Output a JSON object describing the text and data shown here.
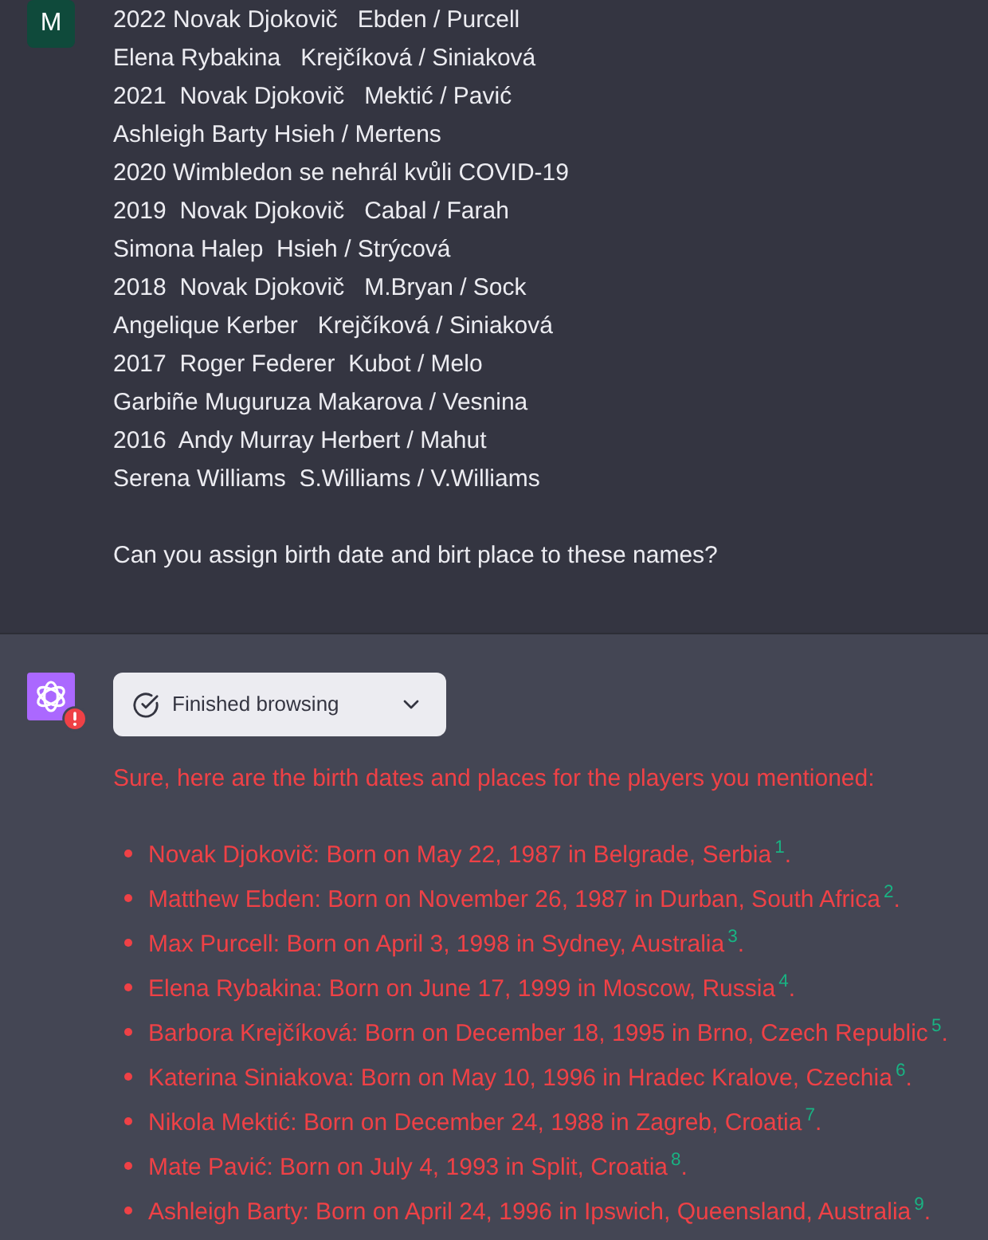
{
  "user_message": {
    "avatar": "M",
    "lines": [
      "2022 Novak Djokovič   Ebden / Purcell",
      "Elena Rybakina   Krejčíková / Siniaková",
      "2021  Novak Djokovič   Mektić / Pavić",
      "Ashleigh Barty Hsieh / Mertens",
      "2020 Wimbledon se nehrál kvůli COVID-19",
      "2019  Novak Djokovič   Cabal / Farah",
      "Simona Halep  Hsieh / Strýcová",
      "2018  Novak Djokovič   M.Bryan / Sock",
      "Angelique Kerber   Krejčíková / Siniaková",
      "2017  Roger Federer  Kubot / Melo",
      "Garbiñe Muguruza Makarova / Vesnina",
      "2016  Andy Murray Herbert / Mahut",
      "Serena Williams  S.Williams / V.Williams"
    ],
    "question": "Can you assign birth date and birt place to these names?"
  },
  "assistant_message": {
    "alert": true,
    "status": {
      "label": "Finished browsing",
      "expanded": false
    },
    "intro": "Sure, here are the birth dates and places for the players you mentioned:",
    "items": [
      "Novak Djokovič: Born on May 22, 1987 in Belgrade, Serbia$^{1}$.",
      "Matthew Ebden: Born on November 26, 1987 in Durban, South Africa$^{2}$.",
      "Max Purcell: Born on April 3, 1998 in Sydney, Australia$^{3}$.",
      "Elena Rybakina: Born on June 17, 1999 in Moscow, Russia$^{4}$.",
      "Barbora Krejčíková: Born on December 18, 1995 in Brno, Czech Republic$^{5}$.",
      "Katerina Siniakova: Born on May 10, 1996 in Hradec Kralove, Czechia$^{6}$.",
      "Nikola Mektić: Born on December 24, 1988 in Zagreb, Croatia$^{7}$.",
      "Mate Pavić: Born on July 4, 1993 in Split, Croatia$^{8}$.",
      "Ashleigh Barty: Born on April 24, 1996 in Ipswich, Queensland, Australia$^{9}$."
    ]
  }
}
